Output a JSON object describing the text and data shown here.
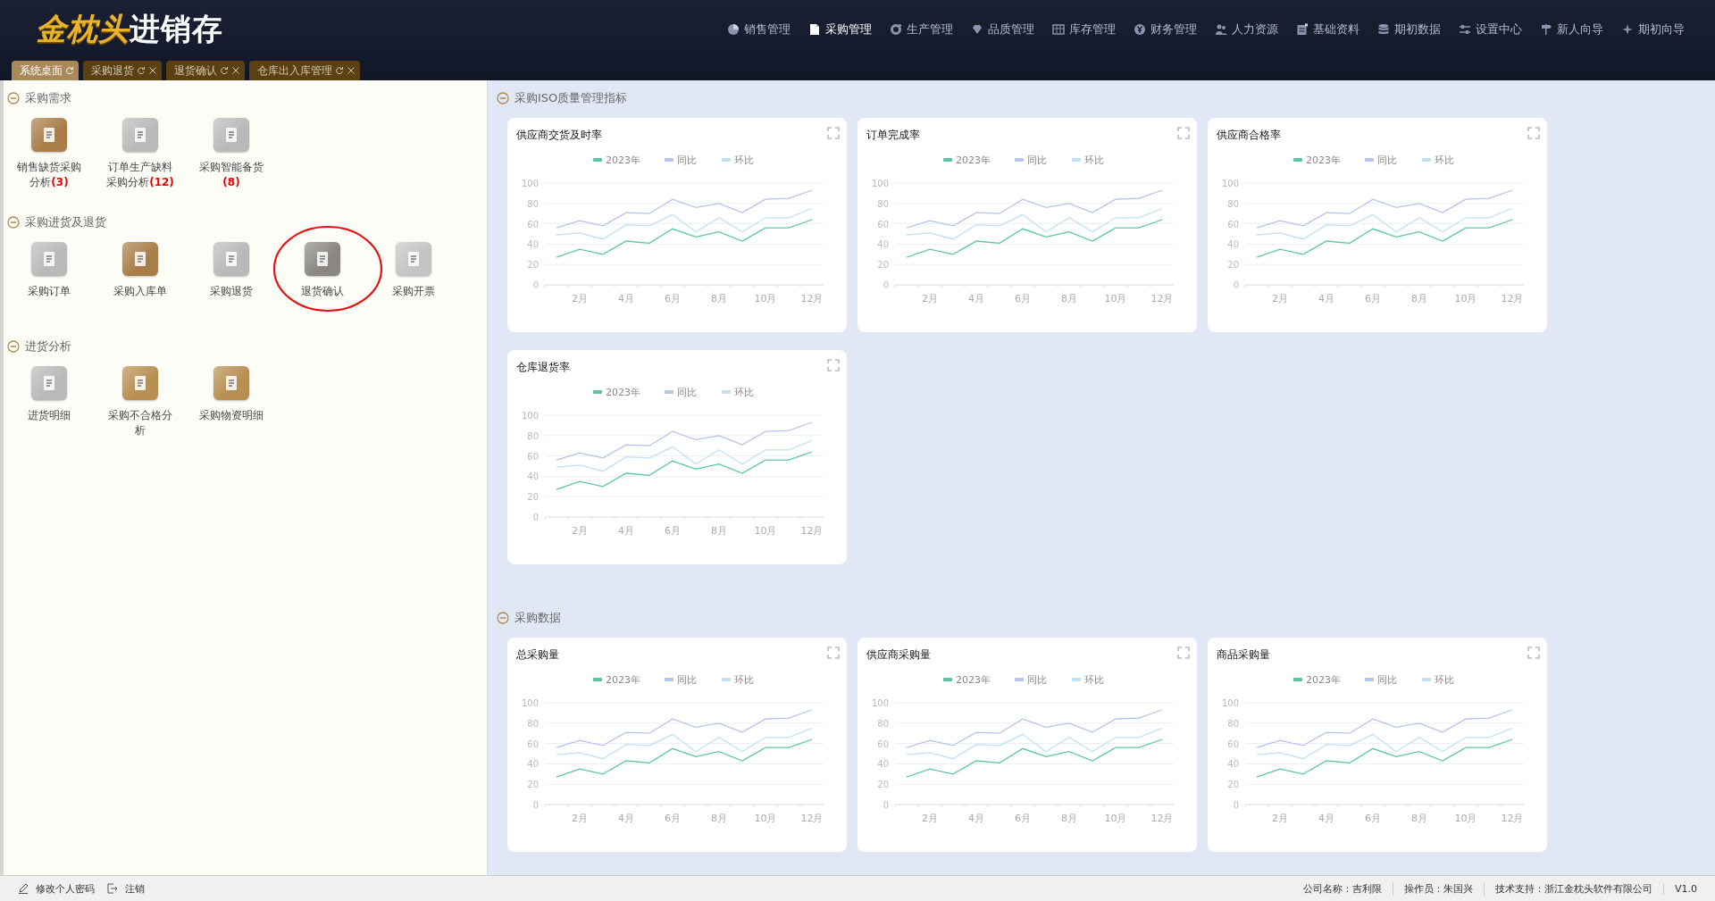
{
  "header": {
    "logo": {
      "brand": "金枕头",
      "product": "进销存"
    },
    "menu": [
      {
        "label": "销售管理",
        "selected": false
      },
      {
        "label": "采购管理",
        "selected": true
      },
      {
        "label": "生产管理",
        "selected": false
      },
      {
        "label": "品质管理",
        "selected": false
      },
      {
        "label": "库存管理",
        "selected": false
      },
      {
        "label": "财务管理",
        "selected": false
      },
      {
        "label": "人力资源",
        "selected": false
      },
      {
        "label": "基础资料",
        "selected": false
      },
      {
        "label": "期初数据",
        "selected": false
      },
      {
        "label": "设置中心",
        "selected": false
      },
      {
        "label": "新人向导",
        "selected": false
      },
      {
        "label": "期初向导",
        "selected": false
      }
    ]
  },
  "tabs": [
    {
      "label": "系统桌面",
      "selected": true,
      "closable": false
    },
    {
      "label": "采购退货",
      "selected": false,
      "closable": true
    },
    {
      "label": "退货确认",
      "selected": false,
      "closable": true
    },
    {
      "label": "仓库出入库管理",
      "selected": false,
      "closable": true
    }
  ],
  "launcher": {
    "groups": [
      {
        "title": "采购需求",
        "expanded": true,
        "items": [
          {
            "label": "销售缺货采购分析",
            "count": "(3)",
            "color": "#a87d48",
            "circled": false
          },
          {
            "label": "订单生产缺料采购分析",
            "count": "(12)",
            "color": "#b9b9b9",
            "circled": false
          },
          {
            "label": "采购智能备货",
            "count": "(8)",
            "color": "#b9b9b9",
            "circled": false
          }
        ]
      },
      {
        "title": "采购进货及退货",
        "expanded": true,
        "items": [
          {
            "label": "采购订单",
            "color": "#b9b9b9",
            "circled": false
          },
          {
            "label": "采购入库单",
            "color": "#a87d48",
            "circled": false
          },
          {
            "label": "采购退货",
            "color": "#b9b9b9",
            "circled": false
          },
          {
            "label": "退货确认",
            "color": "#8a8783",
            "circled": true
          },
          {
            "label": "采购开票",
            "color": "#c4c4c4",
            "circled": false
          }
        ]
      },
      {
        "title": "进货分析",
        "expanded": true,
        "items": [
          {
            "label": "进货明细",
            "color": "#b9b9b9",
            "circled": false
          },
          {
            "label": "采购不合格分析",
            "color": "#b88e52",
            "circled": false
          },
          {
            "label": "采购物资明细",
            "color": "#b88e52",
            "circled": false
          }
        ]
      }
    ]
  },
  "dashboard": {
    "sections": [
      {
        "title": "采购ISO质量管理指标",
        "expanded": true,
        "cards": [
          {
            "title": "供应商交货及时率",
            "chart_data": {
              "type": "line",
              "grid": true,
              "legend": true,
              "xlim": [
                0.5,
                12.5
              ],
              "x": [
                1,
                2,
                3,
                4,
                5,
                6,
                7,
                8,
                9,
                10,
                11,
                12
              ],
              "xticks": [
                {
                  "value": 2,
                  "label": "2月"
                },
                {
                  "value": 4,
                  "label": "4月"
                },
                {
                  "value": 6,
                  "label": "6月"
                },
                {
                  "value": 8,
                  "label": "8月"
                },
                {
                  "value": 10,
                  "label": "10月"
                },
                {
                  "value": 12,
                  "label": "12月"
                }
              ],
              "ylim": [
                0,
                100
              ],
              "yticks": [
                0,
                20,
                40,
                60,
                80,
                100
              ],
              "series": [
                {
                  "name": "2023年",
                  "color": "#5ac89c",
                  "values": [
                    27,
                    35,
                    30,
                    43,
                    41,
                    55,
                    47,
                    52,
                    43,
                    56,
                    56,
                    64
                  ]
                },
                {
                  "name": "同比",
                  "color": "#b3c3ec",
                  "values": [
                    56,
                    63,
                    58,
                    71,
                    70,
                    84,
                    76,
                    80,
                    71,
                    84,
                    85,
                    93
                  ]
                },
                {
                  "name": "环比",
                  "color": "#bfe0f7",
                  "values": [
                    49,
                    51,
                    45,
                    59,
                    58,
                    69,
                    52,
                    66,
                    52,
                    66,
                    66,
                    75
                  ]
                }
              ]
            }
          },
          {
            "title": "订单完成率",
            "chart_data": {
              "type": "line",
              "grid": true,
              "legend": true,
              "xlim": [
                0.5,
                12.5
              ],
              "x": [
                1,
                2,
                3,
                4,
                5,
                6,
                7,
                8,
                9,
                10,
                11,
                12
              ],
              "xticks": [
                {
                  "value": 2,
                  "label": "2月"
                },
                {
                  "value": 4,
                  "label": "4月"
                },
                {
                  "value": 6,
                  "label": "6月"
                },
                {
                  "value": 8,
                  "label": "8月"
                },
                {
                  "value": 10,
                  "label": "10月"
                },
                {
                  "value": 12,
                  "label": "12月"
                }
              ],
              "ylim": [
                0,
                100
              ],
              "yticks": [
                0,
                20,
                40,
                60,
                80,
                100
              ],
              "series": [
                {
                  "name": "2023年",
                  "color": "#5ac89c",
                  "values": [
                    27,
                    35,
                    30,
                    43,
                    41,
                    55,
                    47,
                    52,
                    43,
                    56,
                    56,
                    64
                  ]
                },
                {
                  "name": "同比",
                  "color": "#b3c3ec",
                  "values": [
                    56,
                    63,
                    58,
                    71,
                    70,
                    84,
                    76,
                    80,
                    71,
                    84,
                    85,
                    93
                  ]
                },
                {
                  "name": "环比",
                  "color": "#bfe0f7",
                  "values": [
                    49,
                    51,
                    45,
                    59,
                    58,
                    69,
                    52,
                    66,
                    52,
                    66,
                    66,
                    75
                  ]
                }
              ]
            }
          },
          {
            "title": "供应商合格率",
            "chart_data": {
              "type": "line",
              "grid": true,
              "legend": true,
              "xlim": [
                0.5,
                12.5
              ],
              "x": [
                1,
                2,
                3,
                4,
                5,
                6,
                7,
                8,
                9,
                10,
                11,
                12
              ],
              "xticks": [
                {
                  "value": 2,
                  "label": "2月"
                },
                {
                  "value": 4,
                  "label": "4月"
                },
                {
                  "value": 6,
                  "label": "6月"
                },
                {
                  "value": 8,
                  "label": "8月"
                },
                {
                  "value": 10,
                  "label": "10月"
                },
                {
                  "value": 12,
                  "label": "12月"
                }
              ],
              "ylim": [
                0,
                100
              ],
              "yticks": [
                0,
                20,
                40,
                60,
                80,
                100
              ],
              "series": [
                {
                  "name": "2023年",
                  "color": "#5ac89c",
                  "values": [
                    27,
                    35,
                    30,
                    43,
                    41,
                    55,
                    47,
                    52,
                    43,
                    56,
                    56,
                    64
                  ]
                },
                {
                  "name": "同比",
                  "color": "#b3c3ec",
                  "values": [
                    56,
                    63,
                    58,
                    71,
                    70,
                    84,
                    76,
                    80,
                    71,
                    84,
                    85,
                    93
                  ]
                },
                {
                  "name": "环比",
                  "color": "#bfe0f7",
                  "values": [
                    49,
                    51,
                    45,
                    59,
                    58,
                    69,
                    52,
                    66,
                    52,
                    66,
                    66,
                    75
                  ]
                }
              ]
            }
          },
          {
            "title": "仓库退货率",
            "chart_data": {
              "type": "line",
              "grid": true,
              "legend": true,
              "xlim": [
                0.5,
                12.5
              ],
              "x": [
                1,
                2,
                3,
                4,
                5,
                6,
                7,
                8,
                9,
                10,
                11,
                12
              ],
              "xticks": [
                {
                  "value": 2,
                  "label": "2月"
                },
                {
                  "value": 4,
                  "label": "4月"
                },
                {
                  "value": 6,
                  "label": "6月"
                },
                {
                  "value": 8,
                  "label": "8月"
                },
                {
                  "value": 10,
                  "label": "10月"
                },
                {
                  "value": 12,
                  "label": "12月"
                }
              ],
              "ylim": [
                0,
                100
              ],
              "yticks": [
                0,
                20,
                40,
                60,
                80,
                100
              ],
              "series": [
                {
                  "name": "2023年",
                  "color": "#5ac89c",
                  "values": [
                    27,
                    35,
                    30,
                    43,
                    41,
                    55,
                    47,
                    52,
                    43,
                    56,
                    56,
                    64
                  ]
                },
                {
                  "name": "同比",
                  "color": "#b3c3ec",
                  "values": [
                    56,
                    63,
                    58,
                    71,
                    70,
                    84,
                    76,
                    80,
                    71,
                    84,
                    85,
                    93
                  ]
                },
                {
                  "name": "环比",
                  "color": "#bfe0f7",
                  "values": [
                    49,
                    51,
                    45,
                    59,
                    58,
                    69,
                    52,
                    66,
                    52,
                    66,
                    66,
                    75
                  ]
                }
              ]
            }
          }
        ]
      },
      {
        "title": "采购数据",
        "expanded": true,
        "cards": [
          {
            "title": "总采购量",
            "chart_data": {
              "type": "line",
              "grid": true,
              "legend": true,
              "xlim": [
                0.5,
                12.5
              ],
              "x": [
                1,
                2,
                3,
                4,
                5,
                6,
                7,
                8,
                9,
                10,
                11,
                12
              ],
              "xticks": [
                {
                  "value": 2,
                  "label": "2月"
                },
                {
                  "value": 4,
                  "label": "4月"
                },
                {
                  "value": 6,
                  "label": "6月"
                },
                {
                  "value": 8,
                  "label": "8月"
                },
                {
                  "value": 10,
                  "label": "10月"
                },
                {
                  "value": 12,
                  "label": "12月"
                }
              ],
              "ylim": [
                0,
                100
              ],
              "yticks": [
                0,
                20,
                40,
                60,
                80,
                100
              ],
              "series": [
                {
                  "name": "2023年",
                  "color": "#5ac89c",
                  "values": [
                    27,
                    35,
                    30,
                    43,
                    41,
                    55,
                    47,
                    52,
                    43,
                    56,
                    56,
                    64
                  ]
                },
                {
                  "name": "同比",
                  "color": "#b3c3ec",
                  "values": [
                    56,
                    63,
                    58,
                    71,
                    70,
                    84,
                    76,
                    80,
                    71,
                    84,
                    85,
                    93
                  ]
                },
                {
                  "name": "环比",
                  "color": "#bfe0f7",
                  "values": [
                    49,
                    51,
                    45,
                    59,
                    58,
                    69,
                    52,
                    66,
                    52,
                    66,
                    66,
                    75
                  ]
                }
              ]
            }
          },
          {
            "title": "供应商采购量",
            "chart_data": {
              "type": "line",
              "grid": true,
              "legend": true,
              "xlim": [
                0.5,
                12.5
              ],
              "x": [
                1,
                2,
                3,
                4,
                5,
                6,
                7,
                8,
                9,
                10,
                11,
                12
              ],
              "xticks": [
                {
                  "value": 2,
                  "label": "2月"
                },
                {
                  "value": 4,
                  "label": "4月"
                },
                {
                  "value": 6,
                  "label": "6月"
                },
                {
                  "value": 8,
                  "label": "8月"
                },
                {
                  "value": 10,
                  "label": "10月"
                },
                {
                  "value": 12,
                  "label": "12月"
                }
              ],
              "ylim": [
                0,
                100
              ],
              "yticks": [
                0,
                20,
                40,
                60,
                80,
                100
              ],
              "series": [
                {
                  "name": "2023年",
                  "color": "#5ac89c",
                  "values": [
                    27,
                    35,
                    30,
                    43,
                    41,
                    55,
                    47,
                    52,
                    43,
                    56,
                    56,
                    64
                  ]
                },
                {
                  "name": "同比",
                  "color": "#b3c3ec",
                  "values": [
                    56,
                    63,
                    58,
                    71,
                    70,
                    84,
                    76,
                    80,
                    71,
                    84,
                    85,
                    93
                  ]
                },
                {
                  "name": "环比",
                  "color": "#bfe0f7",
                  "values": [
                    49,
                    51,
                    45,
                    59,
                    58,
                    69,
                    52,
                    66,
                    52,
                    66,
                    66,
                    75
                  ]
                }
              ]
            }
          },
          {
            "title": "商品采购量",
            "chart_data": {
              "type": "line",
              "grid": true,
              "legend": true,
              "xlim": [
                0.5,
                12.5
              ],
              "x": [
                1,
                2,
                3,
                4,
                5,
                6,
                7,
                8,
                9,
                10,
                11,
                12
              ],
              "xticks": [
                {
                  "value": 2,
                  "label": "2月"
                },
                {
                  "value": 4,
                  "label": "4月"
                },
                {
                  "value": 6,
                  "label": "6月"
                },
                {
                  "value": 8,
                  "label": "8月"
                },
                {
                  "value": 10,
                  "label": "10月"
                },
                {
                  "value": 12,
                  "label": "12月"
                }
              ],
              "ylim": [
                0,
                100
              ],
              "yticks": [
                0,
                20,
                40,
                60,
                80,
                100
              ],
              "series": [
                {
                  "name": "2023年",
                  "color": "#5ac89c",
                  "values": [
                    27,
                    35,
                    30,
                    43,
                    41,
                    55,
                    47,
                    52,
                    43,
                    56,
                    56,
                    64
                  ]
                },
                {
                  "name": "同比",
                  "color": "#b3c3ec",
                  "values": [
                    56,
                    63,
                    58,
                    71,
                    70,
                    84,
                    76,
                    80,
                    71,
                    84,
                    85,
                    93
                  ]
                },
                {
                  "name": "环比",
                  "color": "#bfe0f7",
                  "values": [
                    49,
                    51,
                    45,
                    59,
                    58,
                    69,
                    52,
                    66,
                    52,
                    66,
                    66,
                    75
                  ]
                }
              ]
            }
          }
        ]
      }
    ]
  },
  "status_bar": {
    "links": [
      {
        "label": "修改个人密码"
      },
      {
        "label": "注销"
      }
    ],
    "fields": [
      "公司名称：吉利限",
      "操作员：朱国兴",
      "技术支持：浙江金枕头软件有限公司"
    ],
    "version": "V1.0"
  }
}
